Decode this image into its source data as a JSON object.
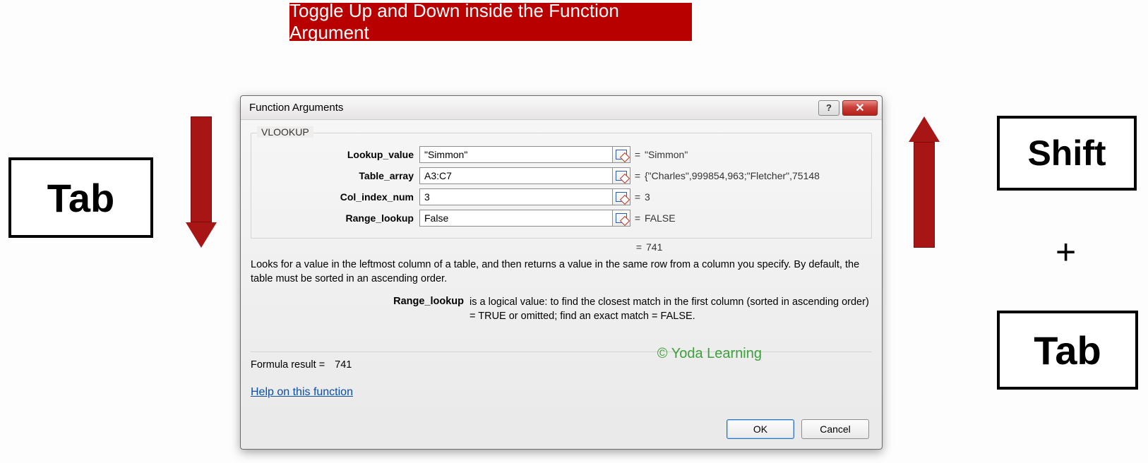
{
  "banner": "Toggle Up and Down inside the Function Argument",
  "keys": {
    "tab_left": "Tab",
    "shift": "Shift",
    "plus": "+",
    "tab_right": "Tab"
  },
  "dialog": {
    "title": "Function Arguments",
    "function_name": "VLOOKUP",
    "fields": [
      {
        "label": "Lookup_value",
        "value": "\"Simmon\"",
        "preview": "\"Simmon\""
      },
      {
        "label": "Table_array",
        "value": "A3:C7",
        "preview": "{\"Charles\",999854,963;\"Fletcher\",75148"
      },
      {
        "label": "Col_index_num",
        "value": "3",
        "preview": "3"
      },
      {
        "label": "Range_lookup",
        "value": "False",
        "preview": "FALSE"
      }
    ],
    "final_preview": "741",
    "description": "Looks for a value in the leftmost column of a table, and then returns a value in the same row from a column you specify. By default, the table must be sorted in an ascending order.",
    "arg_help_name": "Range_lookup",
    "arg_help_desc": "is a logical value: to find the closest match in the first column (sorted in ascending order) = TRUE or omitted; find an exact match = FALSE.",
    "formula_result_label": "Formula result =",
    "formula_result_value": "741",
    "help_link": "Help on this function",
    "ok": "OK",
    "cancel": "Cancel"
  },
  "watermark": "© Yoda Learning"
}
